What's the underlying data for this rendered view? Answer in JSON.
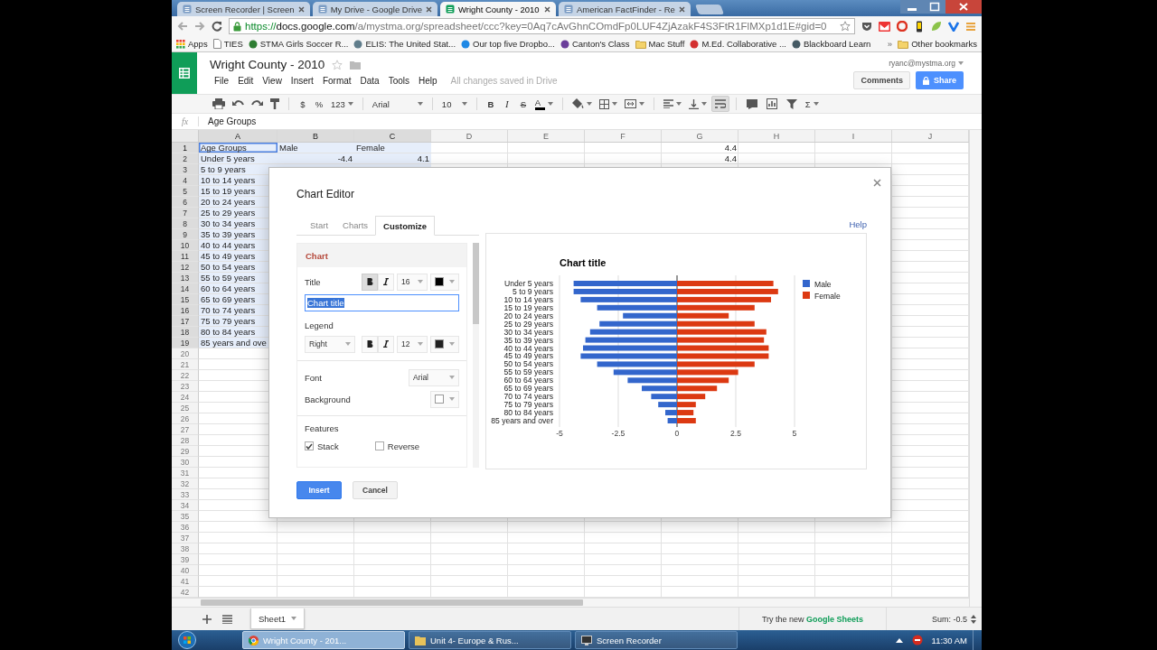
{
  "browser": {
    "tabs": [
      {
        "title": "Screen Recorder | Screen",
        "selected": false
      },
      {
        "title": "My Drive - Google Drive",
        "selected": false
      },
      {
        "title": "Wright County - 2010",
        "selected": true
      },
      {
        "title": "American FactFinder - Re",
        "selected": false
      }
    ],
    "address": {
      "scheme": "https://",
      "host": "docs.google.com",
      "path": "/a/mystma.org/spreadsheet/ccc?key=0Aq7cAvGhnCOmdFp0LUF4ZjAzakF4S3FtR1FlMXp1d1E#gid=0"
    },
    "bookmarks": [
      {
        "label": "Apps",
        "kind": "apps"
      },
      {
        "label": "TIES",
        "kind": "page"
      },
      {
        "label": "STMA Girls Soccer R...",
        "kind": "site",
        "color": "#2e7d32"
      },
      {
        "label": "ELIS: The United Stat...",
        "kind": "site",
        "color": "#607d8b"
      },
      {
        "label": "Our top five Dropbo...",
        "kind": "site",
        "color": "#1e88e5"
      },
      {
        "label": "Canton's Class",
        "kind": "site",
        "color": "#6a3d9a"
      },
      {
        "label": "Mac Stuff",
        "kind": "folder"
      },
      {
        "label": "M.Ed. Collaborative ...",
        "kind": "site",
        "color": "#d32f2f"
      },
      {
        "label": "Blackboard Learn",
        "kind": "site",
        "color": "#455a64"
      }
    ],
    "more_bookmarks": "»",
    "other_bookmarks": "Other bookmarks"
  },
  "sheet": {
    "title": "Wright County - 2010",
    "starred": false,
    "menus": [
      "File",
      "Edit",
      "View",
      "Insert",
      "Format",
      "Data",
      "Tools",
      "Help"
    ],
    "save_status": "All changes saved in Drive",
    "account": "ryanc@mystma.org",
    "comments": "Comments",
    "share": "Share"
  },
  "toolbar": {
    "currency": "$",
    "percent": "%",
    "number_format": "123",
    "font": "Arial",
    "font_size": "10",
    "bold": "B",
    "italic": "I",
    "strike": "S",
    "text_color": "A",
    "functions": "Σ",
    "wrap_selected": true
  },
  "formula": {
    "label": "fx",
    "value": "Age Groups"
  },
  "grid": {
    "columns": [
      {
        "label": "A",
        "selected": true
      },
      {
        "label": "B",
        "selected": true
      },
      {
        "label": "C",
        "selected": true
      },
      {
        "label": "D",
        "selected": false
      },
      {
        "label": "E",
        "selected": false
      },
      {
        "label": "F",
        "selected": false
      },
      {
        "label": "G",
        "selected": false
      },
      {
        "label": "H",
        "selected": false
      },
      {
        "label": "I",
        "selected": false
      },
      {
        "label": "J",
        "selected": false
      }
    ],
    "rows": [
      {
        "number": "1",
        "highlighted": true,
        "selected": true,
        "column_a": "Age Groups",
        "column_b": "Male",
        "column_c": "Female",
        "column_g": "4.4"
      },
      {
        "number": "2",
        "highlighted": true,
        "selected": false,
        "column_a": "Under 5 years",
        "column_b": "-4.4",
        "column_c": "4.1",
        "column_g": "4.4"
      },
      {
        "number": "3",
        "highlighted": true,
        "selected": false,
        "column_a": "5 to 9 years"
      },
      {
        "number": "4",
        "highlighted": true,
        "selected": false,
        "column_a": "10 to 14 years"
      },
      {
        "number": "5",
        "highlighted": true,
        "selected": false,
        "column_a": "15 to 19 years"
      },
      {
        "number": "6",
        "highlighted": true,
        "selected": false,
        "column_a": "20 to 24 years"
      },
      {
        "number": "7",
        "highlighted": true,
        "selected": false,
        "column_a": "25 to 29 years"
      },
      {
        "number": "8",
        "highlighted": true,
        "selected": false,
        "column_a": "30 to 34 years"
      },
      {
        "number": "9",
        "highlighted": true,
        "selected": false,
        "column_a": "35 to 39 years"
      },
      {
        "number": "10",
        "highlighted": true,
        "selected": false,
        "column_a": "40 to 44 years"
      },
      {
        "number": "11",
        "highlighted": true,
        "selected": false,
        "column_a": "45 to 49 years"
      },
      {
        "number": "12",
        "highlighted": true,
        "selected": false,
        "column_a": "50 to 54 years"
      },
      {
        "number": "13",
        "highlighted": true,
        "selected": false,
        "column_a": "55 to 59 years"
      },
      {
        "number": "14",
        "highlighted": true,
        "selected": false,
        "column_a": "60 to 64 years"
      },
      {
        "number": "15",
        "highlighted": true,
        "selected": false,
        "column_a": "65 to 69 years"
      },
      {
        "number": "16",
        "highlighted": true,
        "selected": false,
        "column_a": "70 to 74 years"
      },
      {
        "number": "17",
        "highlighted": true,
        "selected": false,
        "column_a": "75 to 79 years"
      },
      {
        "number": "18",
        "highlighted": true,
        "selected": false,
        "column_a": "80 to 84 years"
      },
      {
        "number": "19",
        "highlighted": true,
        "selected": false,
        "column_a": "85 years and ove"
      },
      {
        "number": "20",
        "highlighted": false,
        "selected": false
      },
      {
        "number": "21",
        "highlighted": false,
        "selected": false
      },
      {
        "number": "22",
        "highlighted": false,
        "selected": false
      },
      {
        "number": "23",
        "highlighted": false,
        "selected": false
      },
      {
        "number": "24",
        "highlighted": false,
        "selected": false
      },
      {
        "number": "25",
        "highlighted": false,
        "selected": false
      },
      {
        "number": "26",
        "highlighted": false,
        "selected": false
      },
      {
        "number": "27",
        "highlighted": false,
        "selected": false
      },
      {
        "number": "28",
        "highlighted": false,
        "selected": false
      },
      {
        "number": "29",
        "highlighted": false,
        "selected": false
      },
      {
        "number": "30",
        "highlighted": false,
        "selected": false
      },
      {
        "number": "31",
        "highlighted": false,
        "selected": false
      },
      {
        "number": "32",
        "highlighted": false,
        "selected": false
      },
      {
        "number": "33",
        "highlighted": false,
        "selected": false
      },
      {
        "number": "34",
        "highlighted": false,
        "selected": false
      },
      {
        "number": "35",
        "highlighted": false,
        "selected": false
      },
      {
        "number": "36",
        "highlighted": false,
        "selected": false
      },
      {
        "number": "37",
        "highlighted": false,
        "selected": false
      },
      {
        "number": "38",
        "highlighted": false,
        "selected": false
      },
      {
        "number": "39",
        "highlighted": false,
        "selected": false
      },
      {
        "number": "40",
        "highlighted": false,
        "selected": false
      },
      {
        "number": "41",
        "highlighted": false,
        "selected": false
      },
      {
        "number": "42",
        "highlighted": false,
        "selected": false
      }
    ]
  },
  "dialog": {
    "title": "Chart Editor",
    "tabs": [
      {
        "label": "Start",
        "selected": false
      },
      {
        "label": "Charts",
        "selected": false
      },
      {
        "label": "Customize",
        "selected": true
      }
    ],
    "help": "Help",
    "section": "Chart",
    "title_row": {
      "label": "Title",
      "bold": true,
      "italic": false,
      "size": "16",
      "color": "#000000"
    },
    "title_field": {
      "value": "Chart title",
      "selected": true
    },
    "legend_row": {
      "label": "Legend",
      "position": "Right",
      "bold": false,
      "italic": false,
      "size": "12",
      "color": "#222222"
    },
    "font_row": {
      "label": "Font",
      "value": "Arial"
    },
    "background_row": {
      "label": "Background",
      "color": "#ffffff"
    },
    "features": {
      "label": "Features",
      "options": [
        {
          "label": "Stack",
          "checked": true
        },
        {
          "label": "Reverse",
          "checked": false
        }
      ]
    },
    "buttons": {
      "insert": "Insert",
      "cancel": "Cancel"
    },
    "chart_data": {
      "type": "bar",
      "orientation": "horizontal",
      "stacked": true,
      "title": "Chart title",
      "categories": [
        "Under 5 years",
        "5 to 9 years",
        "10 to 14 years",
        "15 to 19 years",
        "20 to 24 years",
        "25 to 29 years",
        "30 to 34 years",
        "35 to 39 years",
        "40 to 44 years",
        "45 to 49 years",
        "50 to 54 years",
        "55 to 59 years",
        "60 to 64 years",
        "65 to 69 years",
        "70 to 74 years",
        "75 to 79 years",
        "80 to 84 years",
        "85 years and over"
      ],
      "series": [
        {
          "name": "Male",
          "color": "#3366cc",
          "values": [
            -4.4,
            -4.4,
            -4.1,
            -3.4,
            -2.3,
            -3.3,
            -3.7,
            -3.9,
            -4.0,
            -4.1,
            -3.4,
            -2.7,
            -2.1,
            -1.5,
            -1.1,
            -0.8,
            -0.5,
            -0.4
          ]
        },
        {
          "name": "Female",
          "color": "#dc3912",
          "values": [
            4.1,
            4.3,
            4.0,
            3.3,
            2.2,
            3.3,
            3.8,
            3.7,
            3.9,
            3.9,
            3.3,
            2.6,
            2.2,
            1.7,
            1.2,
            0.8,
            0.7,
            0.8
          ]
        }
      ],
      "xlim": [
        -5,
        5
      ],
      "xticks": [
        -5,
        -2.5,
        0,
        2.5,
        5
      ],
      "legend": "right"
    }
  },
  "sheet_footer": {
    "tabs": [
      {
        "label": "Sheet1",
        "selected": true
      }
    ],
    "promo": "Try the new **Google Sheets**",
    "sum": "Sum: -0.5"
  },
  "taskbar": {
    "tasks": [
      {
        "label": "Wright County - 201...",
        "kind": "browser",
        "selected": true
      },
      {
        "label": "Unit 4- Europe & Rus...",
        "kind": "folder",
        "selected": false
      },
      {
        "label": "Screen Recorder",
        "kind": "recorder",
        "selected": false
      }
    ],
    "clock": "11:30 AM"
  }
}
